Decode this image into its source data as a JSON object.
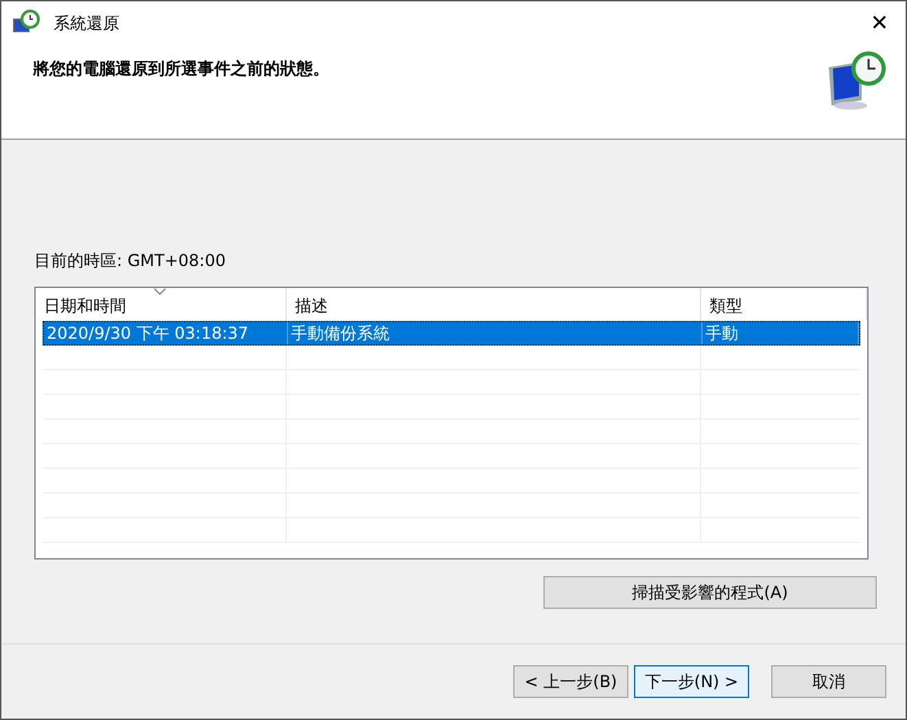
{
  "window": {
    "title": "系統還原",
    "close": "✕"
  },
  "header": {
    "instruction": "將您的電腦還原到所選事件之前的狀態。"
  },
  "timezone": "目前的時區: GMT+08:00",
  "table": {
    "columns": [
      {
        "label": "日期和時間",
        "sorted": true
      },
      {
        "label": "描述",
        "sorted": false
      },
      {
        "label": "類型",
        "sorted": false
      }
    ],
    "rows": [
      {
        "cells": [
          "2020/9/30 下午 03:18:37",
          "手動備份系統",
          "手動"
        ],
        "selected": true
      }
    ]
  },
  "scan_button": "掃描受影響的程式(A)",
  "buttons": [
    {
      "label": "< 上一步(B)",
      "default": false
    },
    {
      "label": "下一步(N) >",
      "default": true
    },
    {
      "label": "取消",
      "default": false
    }
  ]
}
